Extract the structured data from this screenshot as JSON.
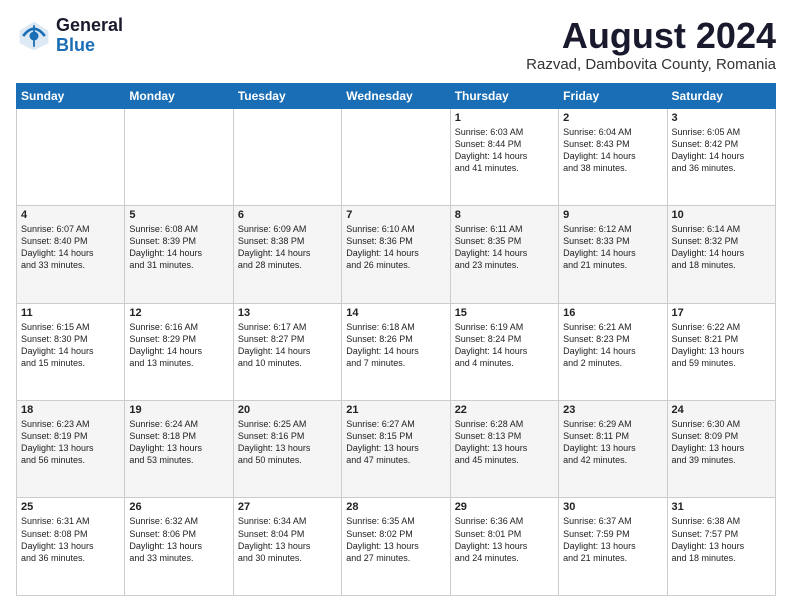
{
  "header": {
    "logo_general": "General",
    "logo_blue": "Blue",
    "title": "August 2024",
    "location": "Razvad, Dambovita County, Romania"
  },
  "days_of_week": [
    "Sunday",
    "Monday",
    "Tuesday",
    "Wednesday",
    "Thursday",
    "Friday",
    "Saturday"
  ],
  "weeks": [
    [
      {
        "day": "",
        "content": ""
      },
      {
        "day": "",
        "content": ""
      },
      {
        "day": "",
        "content": ""
      },
      {
        "day": "",
        "content": ""
      },
      {
        "day": "1",
        "content": "Sunrise: 6:03 AM\nSunset: 8:44 PM\nDaylight: 14 hours\nand 41 minutes."
      },
      {
        "day": "2",
        "content": "Sunrise: 6:04 AM\nSunset: 8:43 PM\nDaylight: 14 hours\nand 38 minutes."
      },
      {
        "day": "3",
        "content": "Sunrise: 6:05 AM\nSunset: 8:42 PM\nDaylight: 14 hours\nand 36 minutes."
      }
    ],
    [
      {
        "day": "4",
        "content": "Sunrise: 6:07 AM\nSunset: 8:40 PM\nDaylight: 14 hours\nand 33 minutes."
      },
      {
        "day": "5",
        "content": "Sunrise: 6:08 AM\nSunset: 8:39 PM\nDaylight: 14 hours\nand 31 minutes."
      },
      {
        "day": "6",
        "content": "Sunrise: 6:09 AM\nSunset: 8:38 PM\nDaylight: 14 hours\nand 28 minutes."
      },
      {
        "day": "7",
        "content": "Sunrise: 6:10 AM\nSunset: 8:36 PM\nDaylight: 14 hours\nand 26 minutes."
      },
      {
        "day": "8",
        "content": "Sunrise: 6:11 AM\nSunset: 8:35 PM\nDaylight: 14 hours\nand 23 minutes."
      },
      {
        "day": "9",
        "content": "Sunrise: 6:12 AM\nSunset: 8:33 PM\nDaylight: 14 hours\nand 21 minutes."
      },
      {
        "day": "10",
        "content": "Sunrise: 6:14 AM\nSunset: 8:32 PM\nDaylight: 14 hours\nand 18 minutes."
      }
    ],
    [
      {
        "day": "11",
        "content": "Sunrise: 6:15 AM\nSunset: 8:30 PM\nDaylight: 14 hours\nand 15 minutes."
      },
      {
        "day": "12",
        "content": "Sunrise: 6:16 AM\nSunset: 8:29 PM\nDaylight: 14 hours\nand 13 minutes."
      },
      {
        "day": "13",
        "content": "Sunrise: 6:17 AM\nSunset: 8:27 PM\nDaylight: 14 hours\nand 10 minutes."
      },
      {
        "day": "14",
        "content": "Sunrise: 6:18 AM\nSunset: 8:26 PM\nDaylight: 14 hours\nand 7 minutes."
      },
      {
        "day": "15",
        "content": "Sunrise: 6:19 AM\nSunset: 8:24 PM\nDaylight: 14 hours\nand 4 minutes."
      },
      {
        "day": "16",
        "content": "Sunrise: 6:21 AM\nSunset: 8:23 PM\nDaylight: 14 hours\nand 2 minutes."
      },
      {
        "day": "17",
        "content": "Sunrise: 6:22 AM\nSunset: 8:21 PM\nDaylight: 13 hours\nand 59 minutes."
      }
    ],
    [
      {
        "day": "18",
        "content": "Sunrise: 6:23 AM\nSunset: 8:19 PM\nDaylight: 13 hours\nand 56 minutes."
      },
      {
        "day": "19",
        "content": "Sunrise: 6:24 AM\nSunset: 8:18 PM\nDaylight: 13 hours\nand 53 minutes."
      },
      {
        "day": "20",
        "content": "Sunrise: 6:25 AM\nSunset: 8:16 PM\nDaylight: 13 hours\nand 50 minutes."
      },
      {
        "day": "21",
        "content": "Sunrise: 6:27 AM\nSunset: 8:15 PM\nDaylight: 13 hours\nand 47 minutes."
      },
      {
        "day": "22",
        "content": "Sunrise: 6:28 AM\nSunset: 8:13 PM\nDaylight: 13 hours\nand 45 minutes."
      },
      {
        "day": "23",
        "content": "Sunrise: 6:29 AM\nSunset: 8:11 PM\nDaylight: 13 hours\nand 42 minutes."
      },
      {
        "day": "24",
        "content": "Sunrise: 6:30 AM\nSunset: 8:09 PM\nDaylight: 13 hours\nand 39 minutes."
      }
    ],
    [
      {
        "day": "25",
        "content": "Sunrise: 6:31 AM\nSunset: 8:08 PM\nDaylight: 13 hours\nand 36 minutes."
      },
      {
        "day": "26",
        "content": "Sunrise: 6:32 AM\nSunset: 8:06 PM\nDaylight: 13 hours\nand 33 minutes."
      },
      {
        "day": "27",
        "content": "Sunrise: 6:34 AM\nSunset: 8:04 PM\nDaylight: 13 hours\nand 30 minutes."
      },
      {
        "day": "28",
        "content": "Sunrise: 6:35 AM\nSunset: 8:02 PM\nDaylight: 13 hours\nand 27 minutes."
      },
      {
        "day": "29",
        "content": "Sunrise: 6:36 AM\nSunset: 8:01 PM\nDaylight: 13 hours\nand 24 minutes."
      },
      {
        "day": "30",
        "content": "Sunrise: 6:37 AM\nSunset: 7:59 PM\nDaylight: 13 hours\nand 21 minutes."
      },
      {
        "day": "31",
        "content": "Sunrise: 6:38 AM\nSunset: 7:57 PM\nDaylight: 13 hours\nand 18 minutes."
      }
    ]
  ]
}
